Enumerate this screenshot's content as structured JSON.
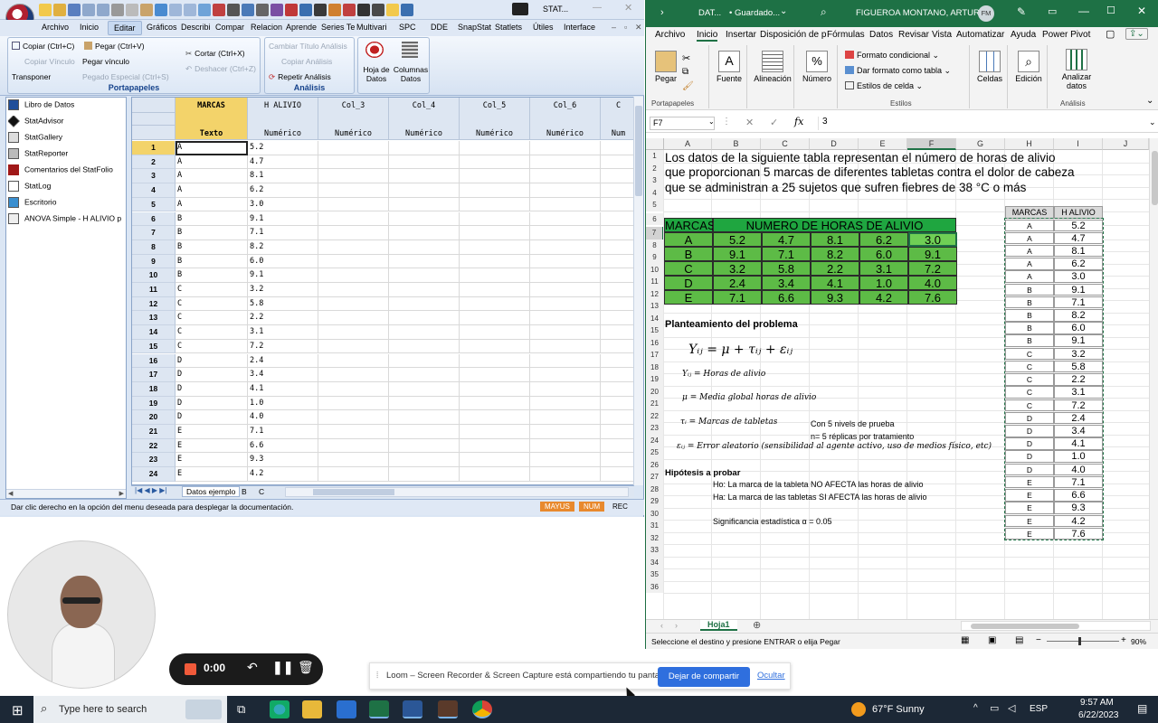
{
  "statgraphics": {
    "title": "STAT...",
    "menu": [
      "Archivo",
      "Inicio",
      "Editar",
      "Gráficos",
      "Describi",
      "Compar",
      "Relacion",
      "Aprende",
      "Series Te",
      "Multivari",
      "SPC",
      "DDE",
      "SnapStat",
      "Statlets",
      "Útiles",
      "Interface"
    ],
    "ribbon": {
      "copy": "Copiar (Ctrl+C)",
      "paste": "Pegar (Ctrl+V)",
      "copy_link": "Copiar Vínculo",
      "paste_link": "Pegar vínculo",
      "cut": "Cortar (Ctrl+X)",
      "transpose": "Transponer",
      "paste_special": "Pegado Especial (Ctrl+S)",
      "undo": "Deshacer (Ctrl+Z)",
      "group_clipboard": "Portapapeles",
      "change_title": "Cambiar Título Análisis",
      "copy_analysis": "Copiar Análisis",
      "repeat_analysis": "Repetir Análisis",
      "group_analysis": "Análisis",
      "data_sheet": "Hoja de Datos",
      "columns": "Columnas Datos"
    },
    "nav": [
      "Libro de Datos",
      "StatAdvisor",
      "StatGallery",
      "StatReporter",
      "Comentarios del StatFolio",
      "StatLog",
      "Escritorio",
      "ANOVA Simple - H ALIVIO p"
    ],
    "columns": [
      {
        "name": "MARCAS",
        "type": "Texto"
      },
      {
        "name": "H ALIVIO",
        "type": "Numérico"
      },
      {
        "name": "Col_3",
        "type": "Numérico"
      },
      {
        "name": "Col_4",
        "type": "Numérico"
      },
      {
        "name": "Col_5",
        "type": "Numérico"
      },
      {
        "name": "Col_6",
        "type": "Numérico"
      },
      {
        "name": "C",
        "type": "Num"
      }
    ],
    "rows": [
      [
        "A",
        "5.2"
      ],
      [
        "A",
        "4.7"
      ],
      [
        "A",
        "8.1"
      ],
      [
        "A",
        "6.2"
      ],
      [
        "A",
        "3.0"
      ],
      [
        "B",
        "9.1"
      ],
      [
        "B",
        "7.1"
      ],
      [
        "B",
        "8.2"
      ],
      [
        "B",
        "6.0"
      ],
      [
        "B",
        "9.1"
      ],
      [
        "C",
        "3.2"
      ],
      [
        "C",
        "5.8"
      ],
      [
        "C",
        "2.2"
      ],
      [
        "C",
        "3.1"
      ],
      [
        "C",
        "7.2"
      ],
      [
        "D",
        "2.4"
      ],
      [
        "D",
        "3.4"
      ],
      [
        "D",
        "4.1"
      ],
      [
        "D",
        "1.0"
      ],
      [
        "D",
        "4.0"
      ],
      [
        "E",
        "7.1"
      ],
      [
        "E",
        "6.6"
      ],
      [
        "E",
        "9.3"
      ],
      [
        "E",
        "4.2"
      ]
    ],
    "sheet_tabs": [
      "Datos ejemplo",
      "B",
      "C"
    ],
    "status_text": "Dar clic derecho en la opción del menu deseada para desplegar la documentación.",
    "status_badges": [
      "MAYUS",
      "NUM",
      "REC"
    ]
  },
  "excel": {
    "title_file": "DAT...",
    "title_state": "• Guardado...",
    "user": "FIGUEROA MONTANO, ARTURO",
    "user_initials": "FM",
    "tabs": [
      "Archivo",
      "Inicio",
      "Insertar",
      "Disposición de p",
      "Fórmulas",
      "Datos",
      "Revisar",
      "Vista",
      "Automatizar",
      "Ayuda",
      "Power Pivot"
    ],
    "ribbon": {
      "paste": "Pegar",
      "clipboard": "Portapapeles",
      "font": "Fuente",
      "align": "Alineación",
      "number": "Número",
      "cond_format": "Formato condicional",
      "table_format": "Dar formato como tabla",
      "cell_styles": "Estilos de celda",
      "styles": "Estilos",
      "cells": "Celdas",
      "edit": "Edición",
      "analyze": "Analizar datos",
      "analysis": "Análisis"
    },
    "name_box": "F7",
    "formula": "3",
    "col_headers": [
      "A",
      "B",
      "C",
      "D",
      "E",
      "F",
      "G",
      "H",
      "I",
      "J"
    ],
    "row_numbers": [
      "1",
      "2",
      "3",
      "4",
      "5",
      "6",
      "7",
      "8",
      "9",
      "10",
      "11",
      "12",
      "13",
      "14",
      "15",
      "16",
      "17",
      "18",
      "19",
      "20",
      "21",
      "22",
      "23",
      "24",
      "25",
      "26",
      "27",
      "28",
      "29",
      "30",
      "31",
      "32",
      "33",
      "34",
      "35",
      "36"
    ],
    "intro": [
      "Los datos de la siguiente tabla representan el número de horas de alivio",
      "que proporcionan 5 marcas de diferentes tabletas contra el dolor de cabeza",
      "que se administran a 25 sujetos que sufren fiebres de 38 °C o más"
    ],
    "table_header": {
      "marcas": "MARCAS",
      "horas": "NUMERO DE HORAS DE ALIVIO"
    },
    "table_rows": [
      {
        "label": "A",
        "values": [
          "5.2",
          "4.7",
          "8.1",
          "6.2",
          "3.0"
        ]
      },
      {
        "label": "B",
        "values": [
          "9.1",
          "7.1",
          "8.2",
          "6.0",
          "9.1"
        ]
      },
      {
        "label": "C",
        "values": [
          "3.2",
          "5.8",
          "2.2",
          "3.1",
          "7.2"
        ]
      },
      {
        "label": "D",
        "values": [
          "2.4",
          "3.4",
          "4.1",
          "1.0",
          "4.0"
        ]
      },
      {
        "label": "E",
        "values": [
          "7.1",
          "6.6",
          "9.3",
          "4.2",
          "7.6"
        ]
      }
    ],
    "problem_title": "Planteamiento del problema",
    "model": "Yᵢⱼ = μ + τᵢⱼ + εᵢⱼ",
    "definitions": [
      "Yᵢⱼ = Horas de alivio",
      "μ = Media global horas de alivio",
      "τᵢ = Marcas de tabletas",
      "εᵢⱼ = Error aleatorio (sensibilidad al agente activo, uso de medios físico, etc)"
    ],
    "levels": "Con 5 nivels de prueba",
    "replicas": "n= 5 réplicas por tratamiento",
    "hypothesis_title": "Hipótesis a probar",
    "h0": "Ho: La marca de la tableta NO AFECTA las horas de alivio",
    "ha": "Ha: La marca de las tabletas SI AFECTA las horas de alivio",
    "alpha": "Significancia estadística α = 0.05",
    "stack_header": [
      "MARCAS",
      "H ALIVIO"
    ],
    "stack_rows": [
      [
        "A",
        "5.2"
      ],
      [
        "A",
        "4.7"
      ],
      [
        "A",
        "8.1"
      ],
      [
        "A",
        "6.2"
      ],
      [
        "A",
        "3.0"
      ],
      [
        "B",
        "9.1"
      ],
      [
        "B",
        "7.1"
      ],
      [
        "B",
        "8.2"
      ],
      [
        "B",
        "6.0"
      ],
      [
        "B",
        "9.1"
      ],
      [
        "C",
        "3.2"
      ],
      [
        "C",
        "5.8"
      ],
      [
        "C",
        "2.2"
      ],
      [
        "C",
        "3.1"
      ],
      [
        "C",
        "7.2"
      ],
      [
        "D",
        "2.4"
      ],
      [
        "D",
        "3.4"
      ],
      [
        "D",
        "4.1"
      ],
      [
        "D",
        "1.0"
      ],
      [
        "D",
        "4.0"
      ],
      [
        "E",
        "7.1"
      ],
      [
        "E",
        "6.6"
      ],
      [
        "E",
        "9.3"
      ],
      [
        "E",
        "4.2"
      ],
      [
        "E",
        "7.6"
      ]
    ],
    "sheet_tab": "Hoja1",
    "status_text": "Seleccione el destino y presione ENTRAR o elija Pegar",
    "zoom": "90%"
  },
  "recorder": {
    "time": "0:00"
  },
  "loom": {
    "message": "Loom – Screen Recorder & Screen Capture está compartiendo tu pantalla.",
    "stop": "Dejar de compartir",
    "hide": "Ocultar"
  },
  "taskbar": {
    "search": "Type here to search",
    "weather": "67°F  Sunny",
    "lang": "ESP",
    "time": "9:57 AM",
    "date": "6/22/2023"
  },
  "colors": {
    "excel_green": "#1e7145",
    "table_green": "#5dbb46",
    "header_green": "#1fa640",
    "loom_blue": "#2f6fde"
  }
}
